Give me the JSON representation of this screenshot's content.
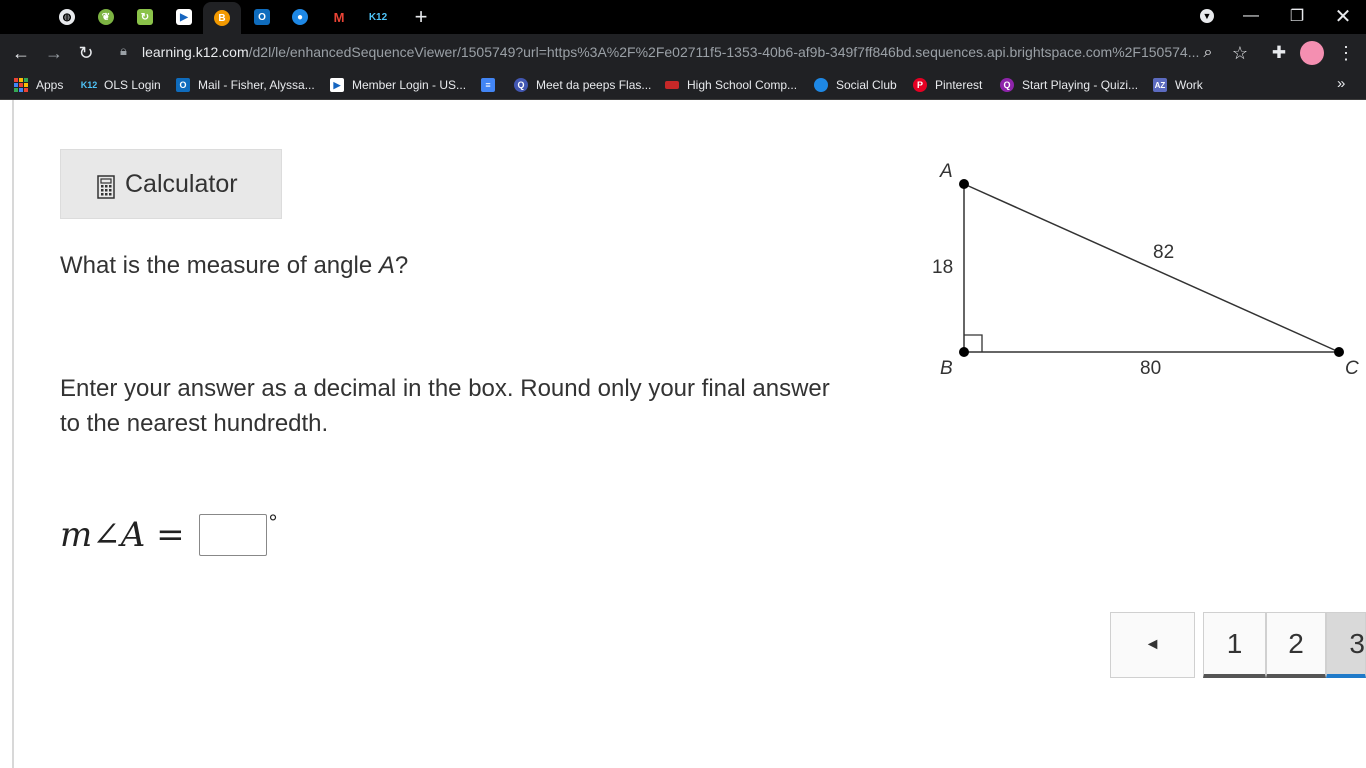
{
  "browser": {
    "tabs": [
      {
        "icon": "globe-icon"
      },
      {
        "icon": "leaf-icon"
      },
      {
        "icon": "refresh-app-icon"
      },
      {
        "icon": "cursor-app-icon"
      },
      {
        "icon": "b-app-icon",
        "active": true
      },
      {
        "icon": "outlook-icon"
      },
      {
        "icon": "earth-icon"
      },
      {
        "icon": "gmail-icon"
      },
      {
        "icon": "k12-icon"
      }
    ],
    "new_tab_glyph": "+",
    "url_host": "learning.k12.com",
    "url_rest": "/d2l/le/enhancedSequenceViewer/1505749?url=https%3A%2F%2Fe02711f5-1353-40b6-af9b-349f7ff846bd.sequences.api.brightspace.com%2F150574...",
    "bookmarks": [
      {
        "label": "Apps",
        "icon": "apps-grid-icon",
        "color": "#ea4335"
      },
      {
        "label": "OLS Login",
        "icon": "k12-icon",
        "color": "#1a73e8",
        "badge": "K12"
      },
      {
        "label": "Mail - Fisher, Alyssa...",
        "icon": "outlook-icon",
        "color": "#0f6cbd",
        "badge": "O"
      },
      {
        "label": "Member Login - US...",
        "icon": "cursor-icon",
        "color": "#1565c0",
        "badge": "▶"
      },
      {
        "label": "",
        "icon": "docs-icon",
        "color": "#4285f4",
        "badge": "≡"
      },
      {
        "label": "Meet da peeps Flas...",
        "icon": "quizlet-icon",
        "color": "#4257b2",
        "badge": "Q"
      },
      {
        "label": "High School Comp...",
        "icon": "flag-icon",
        "color": "#c62828",
        "badge": "▬"
      },
      {
        "label": "Social Club",
        "icon": "earth-icon",
        "color": "#2e7d32",
        "badge": "●"
      },
      {
        "label": "Pinterest",
        "icon": "pinterest-icon",
        "color": "#e60023",
        "badge": "P"
      },
      {
        "label": "Start Playing - Quizi...",
        "icon": "quizizz-icon",
        "color": "#8e24aa",
        "badge": "Q"
      },
      {
        "label": "Work",
        "icon": "az-icon",
        "color": "#5c6bc0",
        "badge": "AZ"
      }
    ],
    "more_glyph": "»"
  },
  "question": {
    "calculator_label": "Calculator",
    "prompt_text": "What is the measure of angle ",
    "prompt_var": "A",
    "prompt_end": "?",
    "instructions": "Enter your answer as a decimal in the box. Round only your final answer to the nearest hundredth.",
    "equation_label": "m∠A =",
    "answer_value": "",
    "degree_symbol": "°"
  },
  "triangle": {
    "vertex_a": "A",
    "vertex_b": "B",
    "vertex_c": "C",
    "side_ab": "18",
    "side_ac": "82",
    "side_bc": "80"
  },
  "pager": {
    "prev_glyph": "◄",
    "pages": [
      "1",
      "2",
      "3"
    ],
    "current": "3"
  }
}
